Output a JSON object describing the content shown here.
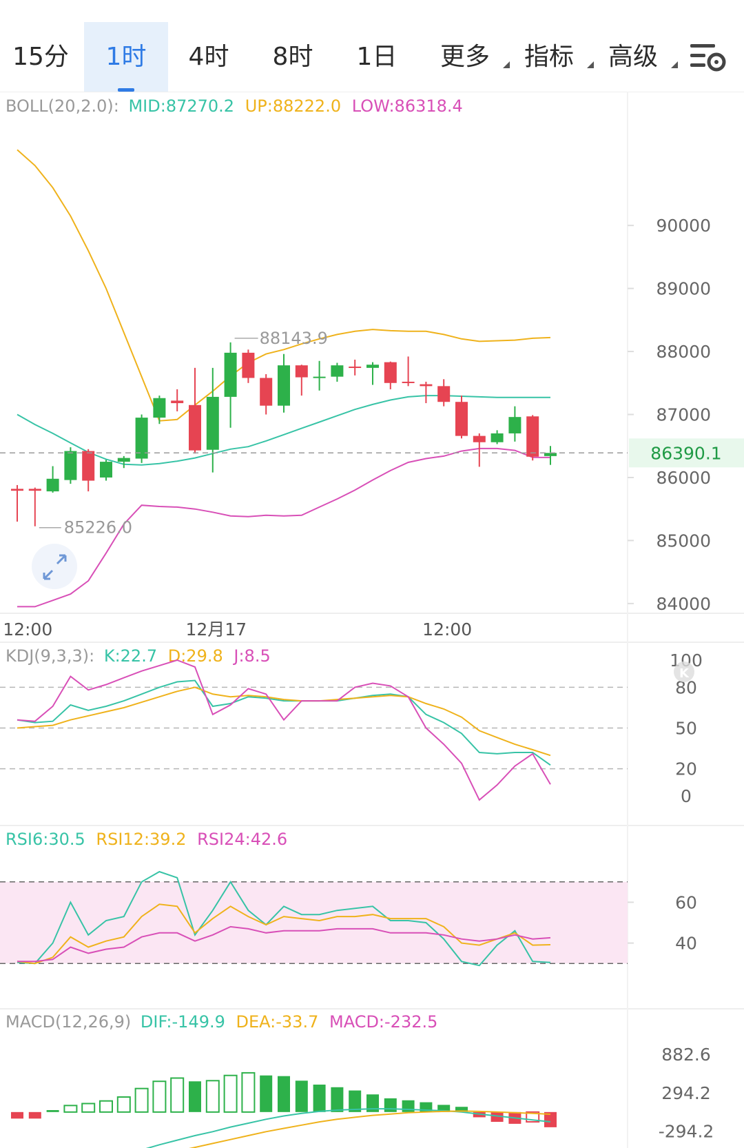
{
  "toolbar": {
    "tabs": [
      {
        "label": "15分",
        "active": false
      },
      {
        "label": "1时",
        "active": true
      },
      {
        "label": "4时",
        "active": false
      },
      {
        "label": "8时",
        "active": false
      },
      {
        "label": "1日",
        "active": false
      },
      {
        "label": "更多",
        "active": false,
        "dropdown": true
      },
      {
        "label": "指标",
        "active": false,
        "dropdown": true
      },
      {
        "label": "高级",
        "active": false,
        "dropdown": true
      }
    ],
    "settings_icon": "chart-settings-icon"
  },
  "colors": {
    "up": "#2db14a",
    "down": "#e64452",
    "mid_line": "#37c3a6",
    "up_line": "#efb21b",
    "low_line": "#d84fb7",
    "current_price_bg": "#e8f8ec",
    "rsi_band": "#fbe6f3"
  },
  "chart_data": [
    {
      "type": "candlestick",
      "panel": "price",
      "indicator": {
        "name": "BOLL(20,2.0):",
        "mid": "MID:87270.2",
        "up": "UP:88222.0",
        "low": "LOW:86318.4"
      },
      "y_ticks": [
        "90000",
        "89000",
        "88000",
        "87000",
        "86000",
        "85000",
        "84000"
      ],
      "ylim": [
        83900,
        91500
      ],
      "x_ticks": [
        {
          "label": "12:00",
          "index": -1
        },
        {
          "label": "12月17",
          "index": 11
        },
        {
          "label": "12:00",
          "index": 24
        }
      ],
      "current_price": "86390.1",
      "current_price_value": 86390.1,
      "high_label": "88143.9",
      "high_value": 88143.9,
      "low_label": "85226.0",
      "low_value": 85226.0,
      "candles": [
        {
          "o": 85820,
          "h": 85880,
          "l": 85300,
          "c": 85790
        },
        {
          "o": 85820,
          "h": 85840,
          "l": 85226,
          "c": 85790
        },
        {
          "o": 85780,
          "h": 86180,
          "l": 85760,
          "c": 85980
        },
        {
          "o": 85960,
          "h": 86480,
          "l": 85900,
          "c": 86420
        },
        {
          "o": 86420,
          "h": 86450,
          "l": 85780,
          "c": 85950
        },
        {
          "o": 86000,
          "h": 86280,
          "l": 85950,
          "c": 86250
        },
        {
          "o": 86250,
          "h": 86340,
          "l": 86150,
          "c": 86310
        },
        {
          "o": 86300,
          "h": 87000,
          "l": 86230,
          "c": 86950
        },
        {
          "o": 86950,
          "h": 87300,
          "l": 86850,
          "c": 87260
        },
        {
          "o": 87220,
          "h": 87400,
          "l": 87050,
          "c": 87180
        },
        {
          "o": 87150,
          "h": 87740,
          "l": 86380,
          "c": 86430
        },
        {
          "o": 86440,
          "h": 87740,
          "l": 86080,
          "c": 87280
        },
        {
          "o": 87280,
          "h": 88143.9,
          "l": 86790,
          "c": 87980
        },
        {
          "o": 87980,
          "h": 88030,
          "l": 87500,
          "c": 87580
        },
        {
          "o": 87580,
          "h": 87640,
          "l": 87000,
          "c": 87140
        },
        {
          "o": 87140,
          "h": 87960,
          "l": 87030,
          "c": 87780
        },
        {
          "o": 87780,
          "h": 87790,
          "l": 87300,
          "c": 87590
        },
        {
          "o": 87580,
          "h": 87850,
          "l": 87380,
          "c": 87600
        },
        {
          "o": 87600,
          "h": 87820,
          "l": 87520,
          "c": 87780
        },
        {
          "o": 87760,
          "h": 87870,
          "l": 87620,
          "c": 87740
        },
        {
          "o": 87740,
          "h": 87830,
          "l": 87470,
          "c": 87790
        },
        {
          "o": 87830,
          "h": 87840,
          "l": 87400,
          "c": 87500
        },
        {
          "o": 87520,
          "h": 87920,
          "l": 87450,
          "c": 87500
        },
        {
          "o": 87480,
          "h": 87520,
          "l": 87180,
          "c": 87450
        },
        {
          "o": 87450,
          "h": 87560,
          "l": 87130,
          "c": 87200
        },
        {
          "o": 87200,
          "h": 87300,
          "l": 86620,
          "c": 86660
        },
        {
          "o": 86660,
          "h": 86700,
          "l": 86170,
          "c": 86560
        },
        {
          "o": 86560,
          "h": 86750,
          "l": 86530,
          "c": 86700
        },
        {
          "o": 86700,
          "h": 87130,
          "l": 86570,
          "c": 86960
        },
        {
          "o": 86970,
          "h": 86990,
          "l": 86270,
          "c": 86330
        },
        {
          "o": 86340,
          "h": 86500,
          "l": 86200,
          "c": 86390
        }
      ],
      "boll_up": [
        91200,
        90950,
        90600,
        90150,
        89600,
        89000,
        88300,
        87600,
        86900,
        86920,
        87150,
        87370,
        87610,
        87820,
        87960,
        88030,
        88120,
        88200,
        88270,
        88320,
        88350,
        88330,
        88320,
        88320,
        88270,
        88200,
        88160,
        88170,
        88180,
        88210,
        88220
      ],
      "boll_mid": [
        87000,
        86840,
        86700,
        86550,
        86400,
        86290,
        86210,
        86200,
        86220,
        86260,
        86310,
        86380,
        86450,
        86490,
        86580,
        86680,
        86780,
        86880,
        86980,
        87080,
        87160,
        87230,
        87280,
        87300,
        87300,
        87290,
        87280,
        87270,
        87270,
        87270,
        87270
      ],
      "boll_low": [
        83950,
        83950,
        84050,
        84150,
        84360,
        84800,
        85260,
        85560,
        85540,
        85530,
        85500,
        85450,
        85390,
        85380,
        85400,
        85390,
        85400,
        85530,
        85660,
        85800,
        85960,
        86110,
        86240,
        86300,
        86340,
        86420,
        86460,
        86460,
        86430,
        86320,
        86318
      ]
    },
    {
      "type": "line",
      "panel": "kdj",
      "indicator": {
        "name": "KDJ(9,3,3):",
        "k": "K:22.7",
        "d": "D:29.8",
        "j": "J:8.5"
      },
      "y_ticks": [
        "100",
        "80",
        "50",
        "20",
        "0"
      ],
      "ylim": [
        0,
        100
      ],
      "series": [
        {
          "key": "K",
          "color": "#37c3a6",
          "values": [
            56,
            54,
            55,
            67,
            63,
            66,
            70,
            75,
            80,
            84,
            85,
            66,
            68,
            73,
            72,
            70,
            70,
            70,
            70,
            72,
            74,
            75,
            73,
            60,
            54,
            46,
            32,
            31,
            32,
            32,
            22.7
          ]
        },
        {
          "key": "D",
          "color": "#efb21b",
          "values": [
            50,
            51,
            52,
            56,
            59,
            62,
            65,
            69,
            73,
            77,
            80,
            75,
            73,
            74,
            73,
            71,
            70,
            70,
            71,
            72,
            73,
            74,
            73,
            68,
            64,
            58,
            48,
            43,
            38,
            34,
            29.8
          ]
        },
        {
          "key": "J",
          "color": "#d84fb7",
          "values": [
            56,
            55,
            66,
            88,
            78,
            82,
            87,
            92,
            96,
            100,
            95,
            60,
            67,
            79,
            75,
            56,
            70,
            70,
            70,
            80,
            83,
            81,
            73,
            50,
            38,
            24,
            -3,
            8,
            22,
            31,
            8.5
          ]
        }
      ]
    },
    {
      "type": "line",
      "panel": "rsi",
      "indicator": {
        "rsi6": "RSI6:30.5",
        "rsi12": "RSI12:39.2",
        "rsi24": "RSI24:42.6"
      },
      "y_ticks": [
        "60",
        "40"
      ],
      "ylim": [
        24,
        76
      ],
      "series": [
        {
          "key": "RSI6",
          "color": "#37c3a6",
          "values": [
            30.5,
            30,
            40,
            60,
            44,
            51,
            53,
            70,
            75,
            72,
            44,
            56,
            70,
            56,
            49,
            58,
            54,
            54,
            56,
            57,
            58,
            51,
            51,
            50,
            42,
            31,
            29,
            39,
            46,
            31,
            30.5
          ]
        },
        {
          "key": "RSI12",
          "color": "#efb21b",
          "values": [
            31,
            30,
            33,
            43,
            38,
            41,
            43,
            53,
            59,
            58,
            45,
            52,
            58,
            53,
            49,
            53,
            52,
            51,
            53,
            53,
            54,
            52,
            52,
            52,
            48,
            40,
            39,
            42,
            45,
            39,
            39.2
          ]
        },
        {
          "key": "RSI24",
          "color": "#d84fb7",
          "values": [
            31,
            31,
            32,
            38,
            35,
            37,
            38,
            43,
            45,
            45,
            41,
            44,
            48,
            47,
            45,
            46,
            46,
            46,
            47,
            47,
            47,
            45,
            45,
            45,
            44,
            42,
            41,
            42,
            44,
            42,
            42.6
          ]
        }
      ]
    },
    {
      "type": "bar",
      "panel": "macd",
      "indicator": {
        "name": "MACD(12,26,9)",
        "dif": "DIF:-149.9",
        "dea": "DEA:-33.7",
        "macd": "MACD:-232.5"
      },
      "y_ticks": [
        "882.6",
        "294.2",
        "-294.2"
      ],
      "y_tick_values": [
        882.6,
        294.2,
        -294.2
      ],
      "ylim": [
        -550,
        1200
      ],
      "histogram": [
        -100,
        -100,
        30,
        100,
        130,
        170,
        230,
        360,
        470,
        520,
        470,
        480,
        560,
        600,
        560,
        550,
        480,
        420,
        380,
        330,
        270,
        210,
        180,
        150,
        110,
        80,
        -80,
        -150,
        -180,
        -150,
        -232.5
      ],
      "dif": [
        -1100,
        -1050,
        -980,
        -900,
        -820,
        -740,
        -660,
        -580,
        -500,
        -430,
        -360,
        -300,
        -230,
        -170,
        -110,
        -60,
        -20,
        10,
        30,
        40,
        50,
        50,
        40,
        30,
        20,
        0,
        -30,
        -60,
        -90,
        -120,
        -149.9
      ],
      "dea": [
        -1000,
        -980,
        -950,
        -910,
        -870,
        -820,
        -770,
        -720,
        -660,
        -600,
        -540,
        -480,
        -420,
        -360,
        -300,
        -250,
        -200,
        -150,
        -110,
        -80,
        -50,
        -30,
        -10,
        0,
        10,
        15,
        10,
        0,
        -10,
        -20,
        -33.7
      ]
    }
  ]
}
